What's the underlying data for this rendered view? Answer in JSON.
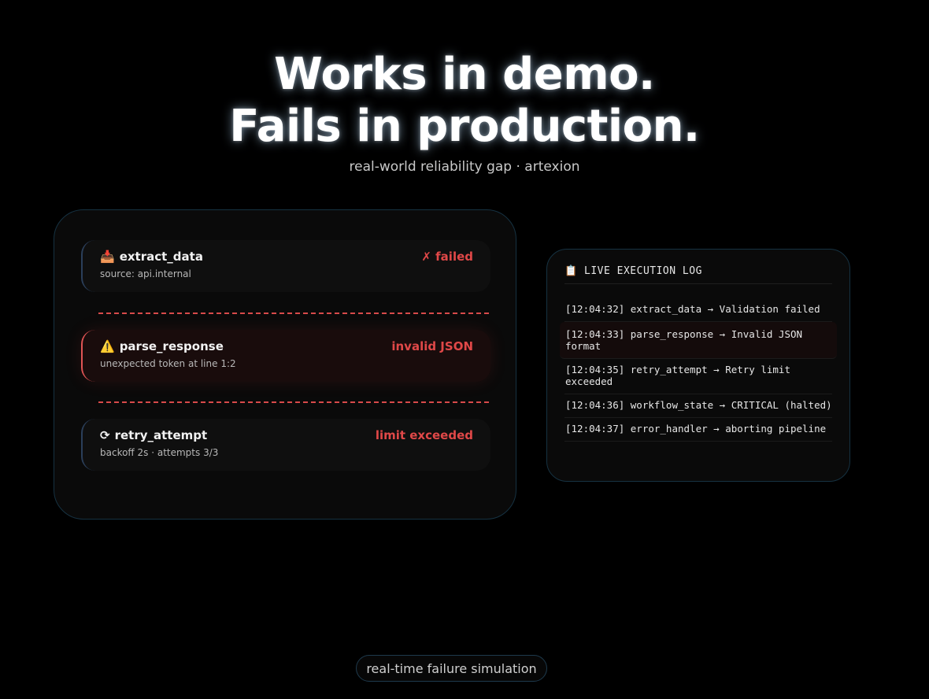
{
  "hero": {
    "title_line1": "Works in demo.",
    "title_line2": "Fails in production.",
    "subtitle": "real-world reliability gap · artexion"
  },
  "pipeline": {
    "steps": [
      {
        "icon": "inbox-tray-icon",
        "icon_glyph": "📥",
        "name": "extract_data",
        "status": "✗ failed",
        "detail": "source: api.internal",
        "state": "normal"
      },
      {
        "icon": "warning-icon",
        "icon_glyph": "⚠️",
        "name": "parse_response",
        "status": "invalid JSON",
        "detail": "unexpected token at line 1:2",
        "state": "highlighted"
      },
      {
        "icon": "retry-icon",
        "icon_glyph": "⟳",
        "name": "retry_attempt",
        "status": "limit exceeded",
        "detail": "backoff 2s · attempts 3/3",
        "state": "normal"
      }
    ],
    "connector_color": "#d84a4a"
  },
  "log": {
    "icon": "clipboard-icon",
    "icon_glyph": "📋",
    "title": "LIVE EXECUTION LOG",
    "entries": [
      "[12:04:32] extract_data → Validation failed",
      "[12:04:33] parse_response → Invalid JSON format",
      "[12:04:35] retry_attempt → Retry limit exceeded",
      "[12:04:36] workflow_state → CRITICAL (halted)",
      "[12:04:37] error_handler → aborting pipeline"
    ],
    "highlighted_index": 1
  },
  "footer": {
    "badge": "real-time failure simulation"
  },
  "colors": {
    "background": "#000000",
    "error": "#e04848",
    "border": "#163242"
  }
}
